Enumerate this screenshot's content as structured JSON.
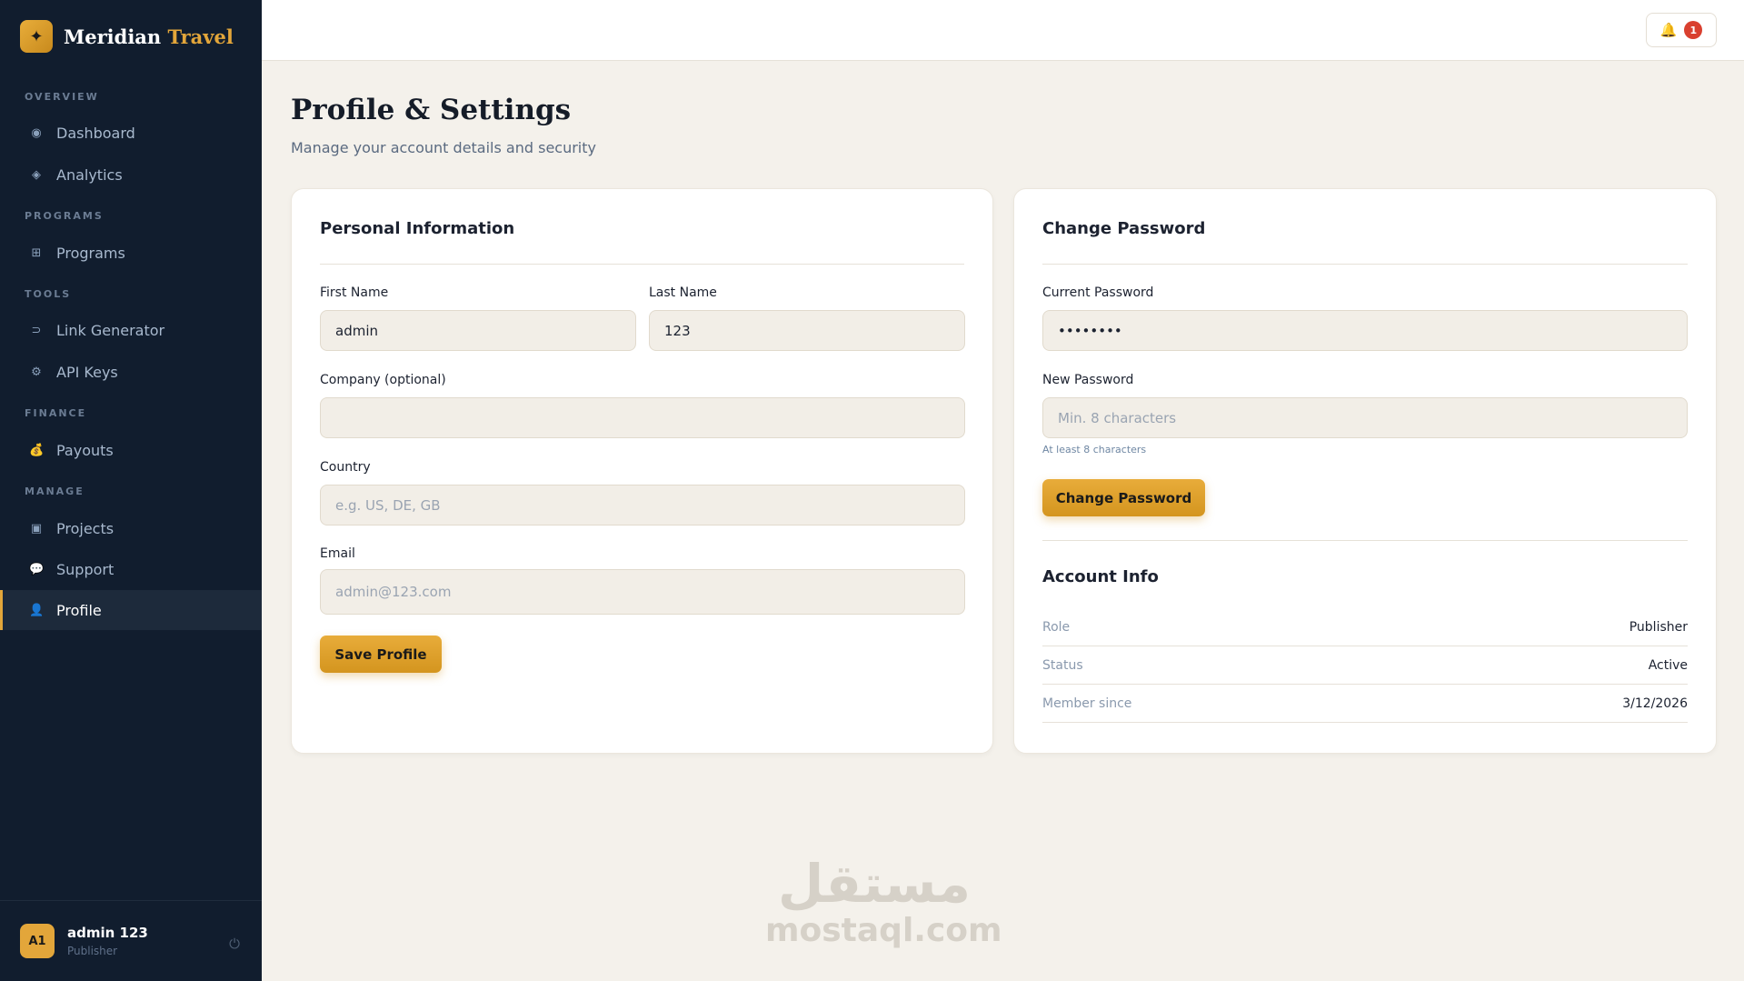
{
  "brand": {
    "logo_glyph": "✦",
    "name_primary": "Meridian",
    "name_accent": "Travel",
    "accent_color": "#e3a63a"
  },
  "sidebar": {
    "sections": [
      "OVERVIEW",
      "PROGRAMS",
      "TOOLS",
      "FINANCE",
      "MANAGE"
    ],
    "items": [
      {
        "label": "Dashboard",
        "icon": "dashboard-dot-icon",
        "glyph": "◉"
      },
      {
        "label": "Analytics",
        "icon": "analytics-diamond-icon",
        "glyph": "◈"
      },
      {
        "label": "Programs",
        "icon": "programs-grid-icon",
        "glyph": "⊞"
      },
      {
        "label": "Link Generator",
        "icon": "link-icon",
        "glyph": "⊃"
      },
      {
        "label": "API Keys",
        "icon": "key-gear-icon",
        "glyph": "⚙"
      },
      {
        "label": "Payouts",
        "icon": "money-bag-icon",
        "glyph": "💰"
      },
      {
        "label": "Projects",
        "icon": "projects-square-icon",
        "glyph": "▣"
      },
      {
        "label": "Support",
        "icon": "chat-bubble-icon",
        "glyph": "💬"
      },
      {
        "label": "Profile",
        "icon": "user-icon",
        "glyph": "👤"
      }
    ],
    "active_item": "Profile",
    "user": {
      "initials": "A1",
      "name": "admin 123",
      "role": "Publisher"
    }
  },
  "topbar": {
    "notification_count": "1",
    "bell_glyph": "🔔"
  },
  "page": {
    "title": "Profile & Settings",
    "subtitle": "Manage your account details and security"
  },
  "personal_info": {
    "title": "Personal Information",
    "first_name_label": "First Name",
    "first_name_value": "admin",
    "last_name_label": "Last Name",
    "last_name_value": "123",
    "company_label": "Company (optional)",
    "company_value": "",
    "country_label": "Country",
    "country_placeholder": "e.g. US, DE, GB",
    "email_label": "Email",
    "email_placeholder": "admin@123.com",
    "save_button": "Save Profile"
  },
  "change_password": {
    "title": "Change Password",
    "current_label": "Current Password",
    "current_value": "••••••••",
    "new_label": "New Password",
    "new_placeholder": "Min. 8 characters",
    "hint": "At least 8 characters",
    "button": "Change Password"
  },
  "account_info": {
    "title": "Account Info",
    "rows": [
      {
        "key": "Role",
        "value": "Publisher"
      },
      {
        "key": "Status",
        "value": "Active"
      },
      {
        "key": "Member since",
        "value": "3/12/2026"
      }
    ]
  },
  "watermark": {
    "arabic": "مستقل",
    "latin": "mostaql.com"
  }
}
